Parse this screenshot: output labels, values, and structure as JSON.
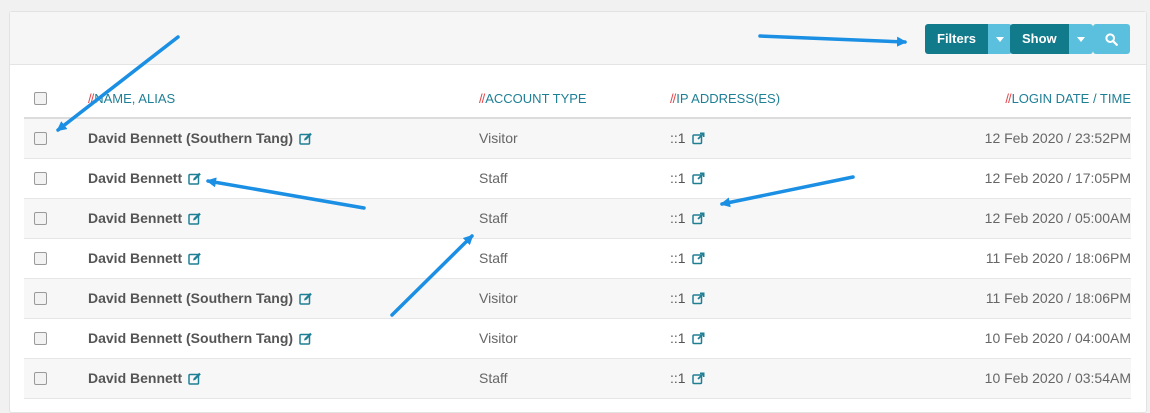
{
  "toolbar": {
    "filters_label": "Filters",
    "show_label": "Show"
  },
  "table": {
    "headers": {
      "name": "NAME, ALIAS",
      "account_type": "ACCOUNT TYPE",
      "ip": "IP ADDRESS(ES)",
      "login": "LOGIN DATE / TIME"
    },
    "header_prefix": "//",
    "rows": [
      {
        "name": "David Bennett (Southern Tang)",
        "account_type": "Visitor",
        "ip": "::1",
        "login": "12 Feb 2020 / 23:52PM"
      },
      {
        "name": "David Bennett",
        "account_type": "Staff",
        "ip": "::1",
        "login": "12 Feb 2020 / 17:05PM"
      },
      {
        "name": "David Bennett",
        "account_type": "Staff",
        "ip": "::1",
        "login": "12 Feb 2020 / 05:00AM"
      },
      {
        "name": "David Bennett",
        "account_type": "Staff",
        "ip": "::1",
        "login": "11 Feb 2020 / 18:06PM"
      },
      {
        "name": "David Bennett (Southern Tang)",
        "account_type": "Visitor",
        "ip": "::1",
        "login": "11 Feb 2020 / 18:06PM"
      },
      {
        "name": "David Bennett (Southern Tang)",
        "account_type": "Visitor",
        "ip": "::1",
        "login": "10 Feb 2020 / 04:00AM"
      },
      {
        "name": "David Bennett",
        "account_type": "Staff",
        "ip": "::1",
        "login": "10 Feb 2020 / 03:54AM"
      }
    ]
  },
  "icons": {
    "edit": "edit-icon",
    "external_link": "external-link-icon",
    "search": "search-icon",
    "caret": "caret-down-icon"
  },
  "colors": {
    "primary_button": "#117a8b",
    "secondary_button": "#5bc0de",
    "header_text": "#1f7f95",
    "header_slash": "#e0474c",
    "annotation_arrow": "#1a8fe3"
  }
}
